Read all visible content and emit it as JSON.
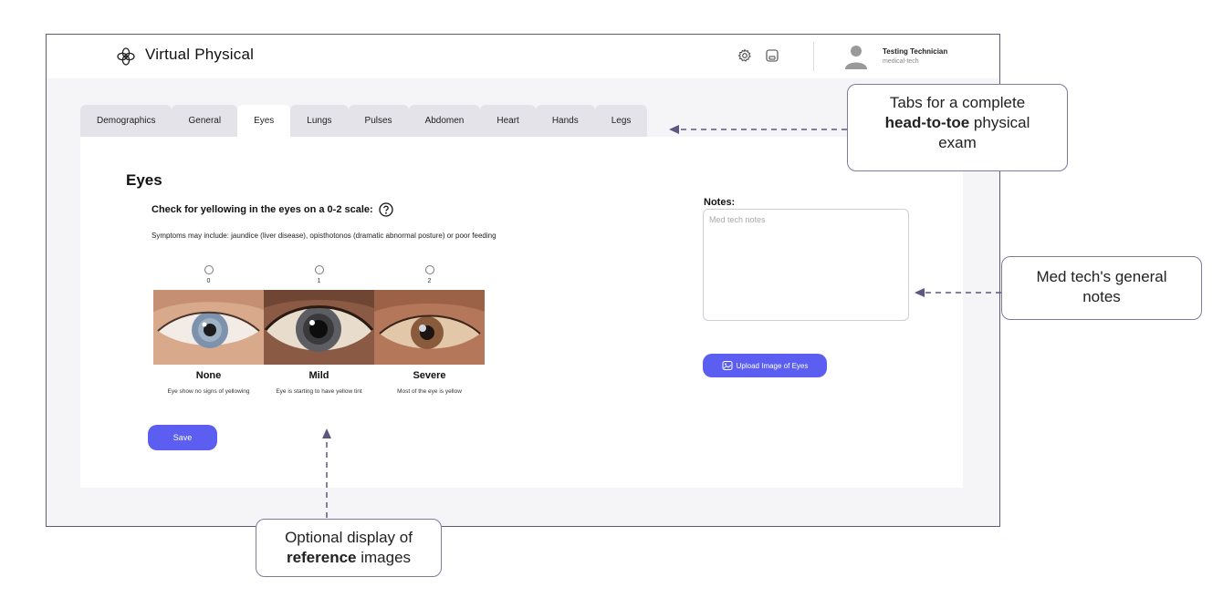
{
  "app": {
    "title": "Virtual Physical",
    "user_name": "Testing Technician",
    "user_role": "medical-tech"
  },
  "tabs": [
    {
      "label": "Demographics",
      "active": false
    },
    {
      "label": "General",
      "active": false
    },
    {
      "label": "Eyes",
      "active": true
    },
    {
      "label": "Lungs",
      "active": false
    },
    {
      "label": "Pulses",
      "active": false
    },
    {
      "label": "Abdomen",
      "active": false
    },
    {
      "label": "Heart",
      "active": false
    },
    {
      "label": "Hands",
      "active": false
    },
    {
      "label": "Legs",
      "active": false
    }
  ],
  "section": {
    "title": "Eyes",
    "question": "Check for yellowing in the eyes on a 0-2 scale:",
    "symptoms": "Symptoms may include: jaundice (liver disease), opisthotonos (dramatic abnormal posture) or poor feeding"
  },
  "options": [
    {
      "value": "0",
      "label": "None",
      "description": "Eye show no signs of yellowing"
    },
    {
      "value": "1",
      "label": "Mild",
      "description": "Eye is starting to have yellow tint"
    },
    {
      "value": "2",
      "label": "Severe",
      "description": "Most of the eye is yellow"
    }
  ],
  "buttons": {
    "save": "Save",
    "upload": "Upload Image of Eyes"
  },
  "notes": {
    "label": "Notes:",
    "placeholder": "Med tech notes",
    "value": ""
  },
  "callouts": {
    "tabs": {
      "line1": "Tabs for a complete",
      "bold": "head-to-toe",
      "rest": " physical",
      "line3": "exam"
    },
    "notes": {
      "line1": "Med tech's general",
      "line2": "notes"
    },
    "reference": {
      "line1": "Optional display of",
      "bold": "reference",
      "rest": " images"
    }
  },
  "colors": {
    "accent": "#5b5ef0",
    "callout_border": "#7e7a9c"
  },
  "icons": [
    "logo-icon",
    "gear-icon",
    "save-icon",
    "avatar-icon",
    "help-icon",
    "image-upload-icon"
  ]
}
